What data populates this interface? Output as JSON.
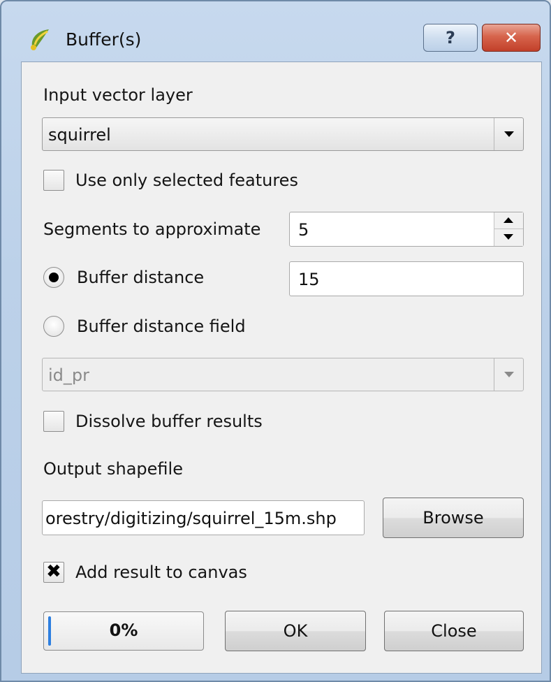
{
  "window": {
    "title": "Buffer(s)",
    "help_label": "?",
    "close_label": "✕"
  },
  "input_layer": {
    "label": "Input vector layer",
    "value": "squirrel"
  },
  "selected_features": {
    "label": "Use only selected features",
    "checked": false
  },
  "segments": {
    "label": "Segments to approximate",
    "value": "5"
  },
  "buffer_distance": {
    "label": "Buffer distance",
    "value": "15",
    "selected": true
  },
  "buffer_distance_field": {
    "label": "Buffer distance field",
    "value": "id_pr",
    "selected": false
  },
  "dissolve": {
    "label": "Dissolve buffer results",
    "checked": false
  },
  "output": {
    "label": "Output shapefile",
    "value": "orestry/digitizing/squirrel_15m.shp",
    "browse_label": "Browse"
  },
  "add_canvas": {
    "label": "Add result to canvas",
    "checked": true
  },
  "progress": {
    "text": "0%",
    "value": 0
  },
  "buttons": {
    "ok": "OK",
    "close": "Close"
  },
  "colors": {
    "title_gradient": "#c7d9ee",
    "close_button": "#c2402a",
    "progress_fill": "#2d7fe0"
  }
}
